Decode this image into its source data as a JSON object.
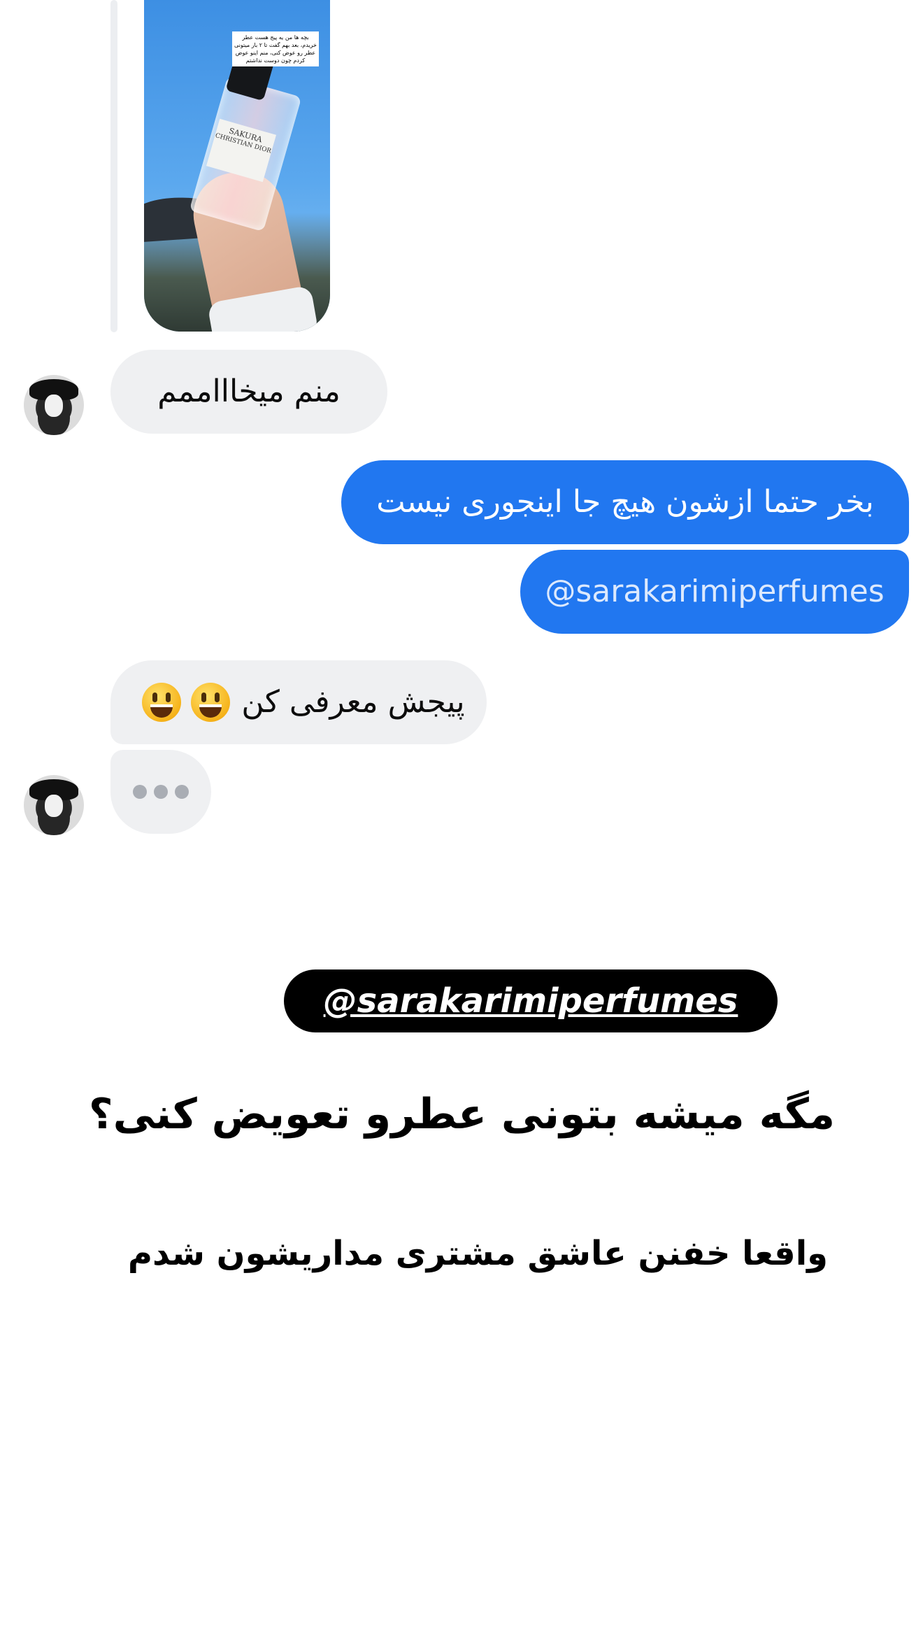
{
  "story_reply": {
    "caption": "بچه ها من یه پیج هست عطر خریدم، بعد بهم گفت تا ۲ بار میتونی عطر رو عوض کنی، منم اینو عوض کردم چون دوست نداشتم",
    "bottle_brand": "SAKURA",
    "bottle_maker": "CHRISTIAN DIOR"
  },
  "messages": [
    {
      "id": "m1",
      "direction": "incoming",
      "text": "منم میخاااممم"
    },
    {
      "id": "m2",
      "direction": "outgoing",
      "text": "بخر حتما ازشون هیچ جا اینجوری نیست"
    },
    {
      "id": "m3",
      "direction": "outgoing",
      "text": "@sarakarimiperfumes"
    },
    {
      "id": "m4",
      "direction": "incoming",
      "text": "پیجش معرفی کن",
      "emoji": [
        "grinning-face",
        "grinning-face"
      ]
    },
    {
      "id": "m5",
      "direction": "incoming",
      "typing": true
    }
  ],
  "overlay": {
    "handle": "@sarakarimiperfumes",
    "line1": "مگه میشه بتونی عطرو تعویض کنی؟",
    "line2": "واقعا خفنن عاشق مشتری مداریشون شدم"
  },
  "colors": {
    "outgoing_bubble": "#2177f0",
    "incoming_bubble": "#eff0f2",
    "pill": "#000000"
  }
}
